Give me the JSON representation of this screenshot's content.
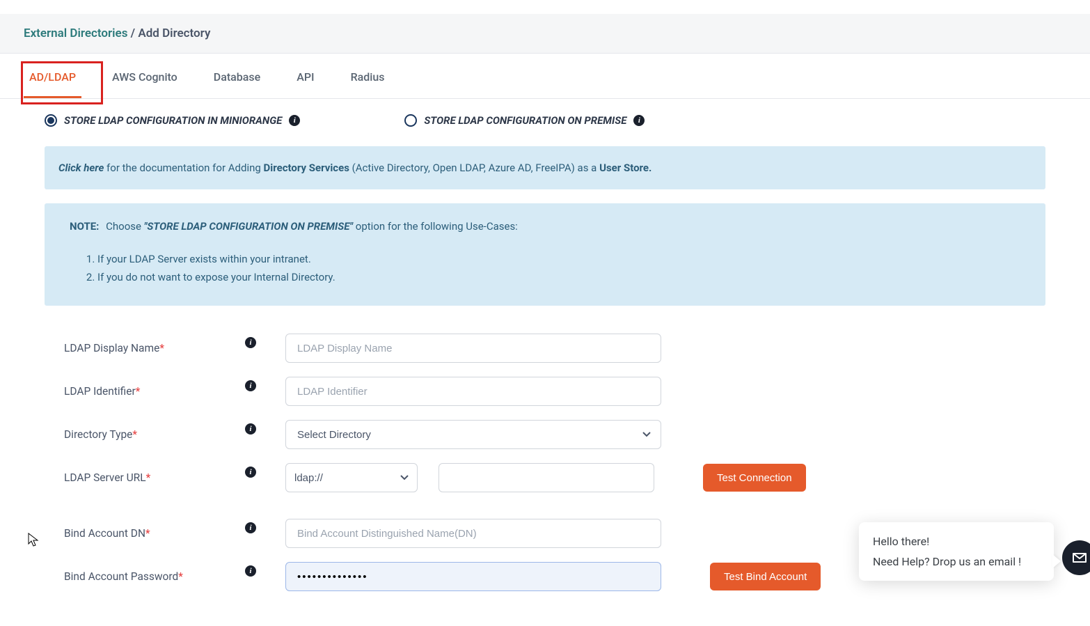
{
  "breadcrumb": {
    "link": "External Directories",
    "sep": "/",
    "current": "Add Directory"
  },
  "tabs": [
    "AD/LDAP",
    "AWS Cognito",
    "Database",
    "API",
    "Radius"
  ],
  "radios": {
    "opt1": "STORE LDAP CONFIGURATION IN MINIORANGE",
    "opt2": "STORE LDAP CONFIGURATION ON PREMISE"
  },
  "doc_alert": {
    "link": "Click here",
    "t1": " for the documentation for Adding ",
    "b1": "Directory Services",
    "t2": " (Active Directory, Open LDAP, Azure AD, FreeIPA) as a ",
    "b2": "User Store."
  },
  "note": {
    "label": "NOTE:",
    "pre": "Choose ",
    "em": "\"STORE LDAP CONFIGURATION ON PREMISE\"",
    "post": " option for the following Use-Cases:",
    "items": [
      "If your LDAP Server exists within your intranet.",
      "If you do not want to expose your Internal Directory."
    ]
  },
  "form": {
    "display_name": {
      "label": "LDAP Display Name",
      "placeholder": "LDAP Display Name"
    },
    "identifier": {
      "label": "LDAP Identifier",
      "placeholder": "LDAP Identifier"
    },
    "dir_type": {
      "label": "Directory Type",
      "selected": "Select Directory"
    },
    "server_url": {
      "label": "LDAP Server URL",
      "proto": "ldap://",
      "btn": "Test Connection"
    },
    "bind_dn": {
      "label": "Bind Account DN",
      "placeholder": "Bind Account Distinguished Name(DN)"
    },
    "bind_pw": {
      "label": "Bind Account Password",
      "value": "••••••••••••••",
      "btn": "Test Bind Account"
    }
  },
  "chat": {
    "line1": "Hello there!",
    "line2": "Need Help? Drop us an email !"
  }
}
